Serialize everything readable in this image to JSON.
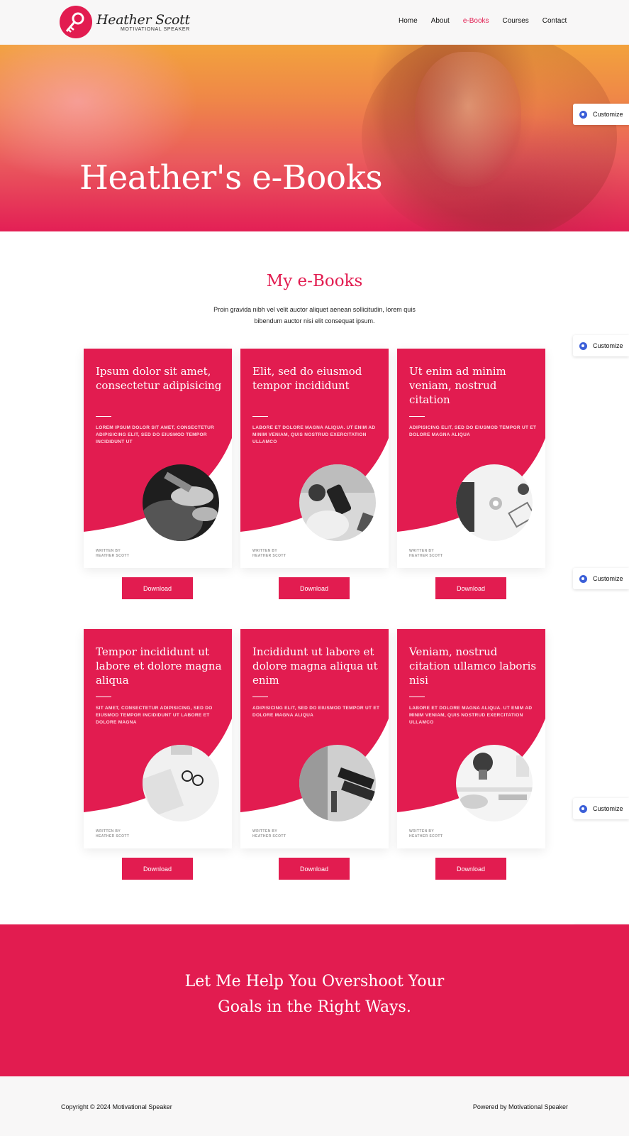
{
  "header": {
    "brand_name": "Heather Scott",
    "brand_tagline": "MOTIVATIONAL SPEAKER",
    "nav": [
      {
        "label": "Home",
        "active": false
      },
      {
        "label": "About",
        "active": false
      },
      {
        "label": "e-Books",
        "active": true
      },
      {
        "label": "Courses",
        "active": false
      },
      {
        "label": "Contact",
        "active": false
      }
    ]
  },
  "hero": {
    "title": "Heather's e-Books"
  },
  "customize_label": "Customize",
  "section": {
    "title": "My e-Books",
    "description": "Proin gravida nibh vel velit auctor aliquet aenean sollicitudin, lorem quis bibendum auctor nisi elit consequat ipsum."
  },
  "books": [
    {
      "title": "Ipsum dolor sit amet, consectetur adipisicing",
      "subtitle": "LOREM IPSUM DOLOR SIT AMET, CONSECTETUR ADIPISICING ELIT, SED DO EIUSMOD TEMPOR INCIDIDUNT UT",
      "written_by": "WRITTEN BY",
      "author": "HEATHER SCOTT",
      "photo": "handshake",
      "button": "Download"
    },
    {
      "title": "Elit, sed do eiusmod tempor incididunt",
      "subtitle": "LABORE ET DOLORE MAGNA ALIQUA. UT ENIM AD MINIM VENIAM, QUIS NOSTRUD EXERCITATION ULLAMCO",
      "written_by": "WRITTEN BY",
      "author": "HEATHER SCOTT",
      "photo": "phone-coffee",
      "button": "Download"
    },
    {
      "title": "Ut enim ad minim veniam, nostrud citation",
      "subtitle": "ADIPISICING ELIT, SED DO EIUSMOD TEMPOR UT ET DOLORE MAGNA ALIQUA",
      "written_by": "WRITTEN BY",
      "author": "HEATHER SCOTT",
      "photo": "desk-laptop",
      "button": "Download"
    },
    {
      "title": "Tempor incididunt ut labore et dolore magna aliqua",
      "subtitle": "SIT AMET, CONSECTETUR ADIPISICING, SED DO EIUSMOD TEMPOR INCIDIDUNT UT LABORE ET DOLORE MAGNA",
      "written_by": "WRITTEN BY",
      "author": "HEATHER SCOTT",
      "photo": "glasses-notebook",
      "button": "Download"
    },
    {
      "title": "Incididunt ut labore et dolore magna aliqua ut enim",
      "subtitle": "ADIPISICING ELIT, SED DO EIUSMOD TEMPOR UT ET DOLORE MAGNA ALIQUA",
      "written_by": "WRITTEN BY",
      "author": "HEATHER SCOTT",
      "photo": "books-window",
      "button": "Download"
    },
    {
      "title": "Veniam, nostrud citation ullamco laboris nisi",
      "subtitle": "LABORE ET DOLORE MAGNA ALIQUA. UT ENIM AD MINIM VENIAM, QUIS NOSTRUD EXERCITATION ULLAMCO",
      "written_by": "WRITTEN BY",
      "author": "HEATHER SCOTT",
      "photo": "plant-workspace",
      "button": "Download"
    }
  ],
  "cta": {
    "line1": "Let Me Help You Overshoot Your",
    "line2": "Goals in the Right Ways."
  },
  "footer": {
    "copyright": "Copyright © 2024 Motivational Speaker",
    "powered": "Powered by Motivational Speaker"
  },
  "colors": {
    "accent": "#e21c50",
    "footer_bg": "#f8f7f7"
  }
}
